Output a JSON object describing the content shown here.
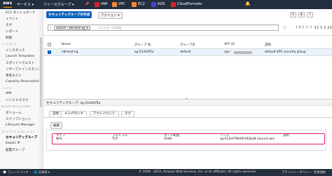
{
  "nav": {
    "logo": "aws",
    "services": "サービス",
    "resource_groups": "リソースグループ",
    "shortcuts": [
      {
        "label": "IAM",
        "icon": "iam-icon",
        "color": "#d6232e"
      },
      {
        "label": "VPC",
        "icon": "vpc-icon",
        "color": "#f58536"
      },
      {
        "label": "EC2",
        "icon": "ec2-icon",
        "color": "#f58536"
      },
      {
        "label": "RDS",
        "icon": "rds-icon",
        "color": "#3b48cc"
      },
      {
        "label": "CloudFormatic",
        "icon": "cloudformation-icon",
        "color": "#d6232e"
      }
    ],
    "bell": "🔔"
  },
  "sidebar": {
    "items": [
      {
        "label": "EC2 ダッシュボード",
        "type": "item"
      },
      {
        "label": "イベント",
        "type": "item"
      },
      {
        "label": "タグ",
        "type": "item"
      },
      {
        "label": "レポート",
        "type": "item"
      },
      {
        "label": "制限",
        "type": "item"
      },
      {
        "label": "インスタンス",
        "type": "section"
      },
      {
        "label": "インスタンス",
        "type": "item"
      },
      {
        "label": "Launch Templates",
        "type": "item"
      },
      {
        "label": "スポットリクエスト",
        "type": "item"
      },
      {
        "label": "リザーブドインスタンス",
        "type": "item"
      },
      {
        "label": "専有ホスト",
        "type": "item"
      },
      {
        "label": "Capacity Reservations",
        "type": "item"
      },
      {
        "label": "イメージ",
        "type": "section"
      },
      {
        "label": "AMI",
        "type": "item"
      },
      {
        "label": "バンドルタスク",
        "type": "item"
      },
      {
        "label": "ELASTIC BLOCK STORE",
        "type": "section"
      },
      {
        "label": "ボリューム",
        "type": "item"
      },
      {
        "label": "スナップショット",
        "type": "item"
      },
      {
        "label": "Lifecycle Manager",
        "type": "item"
      },
      {
        "label": "ネットワーク & セキュリティ",
        "type": "section"
      },
      {
        "label": "セキュリティグループ",
        "type": "active"
      },
      {
        "label": "Elastic IP",
        "type": "item"
      },
      {
        "label": "配置グループ",
        "type": "item"
      }
    ]
  },
  "toolbar": {
    "create_btn": "セキュリティグループの作成",
    "action_btn": "アクション ▾"
  },
  "search": {
    "tag": "search : elb-test-sg",
    "placeholder": "フィルターの追加",
    "pager": "1 から 1 / 1"
  },
  "table": {
    "headers": [
      "Name",
      "グループ ID",
      "グループ名",
      "VPC ID",
      "説明"
    ],
    "rows": [
      [
        "elb-test-sg",
        "sg-21dd1f5a",
        "default",
        "vpc-",
        "default VPC security group"
      ]
    ]
  },
  "detail": {
    "title": "セキュリティグループ: sg-21dd1f5a",
    "tabs": [
      "説明",
      "インバウンド",
      "アウトバウンド",
      "タグ"
    ],
    "edit_btn": "編集",
    "headers": [
      "タイプ",
      "プロトコル",
      "ポート範囲",
      "ソース",
      "説明"
    ],
    "rows": [
      [
        "NFS",
        "TCP",
        "2049",
        "sg-012ef7964f4162be8 (launch-wiz",
        ""
      ]
    ]
  },
  "footer": {
    "feedback": "フィードバック",
    "language": "日本語",
    "copyright": "© 2008 - 2019, Amazon Web Services, Inc. or its affiliates. All rights reserved.",
    "privacy": "プライバシーポリシー",
    "terms": "利用規約"
  }
}
